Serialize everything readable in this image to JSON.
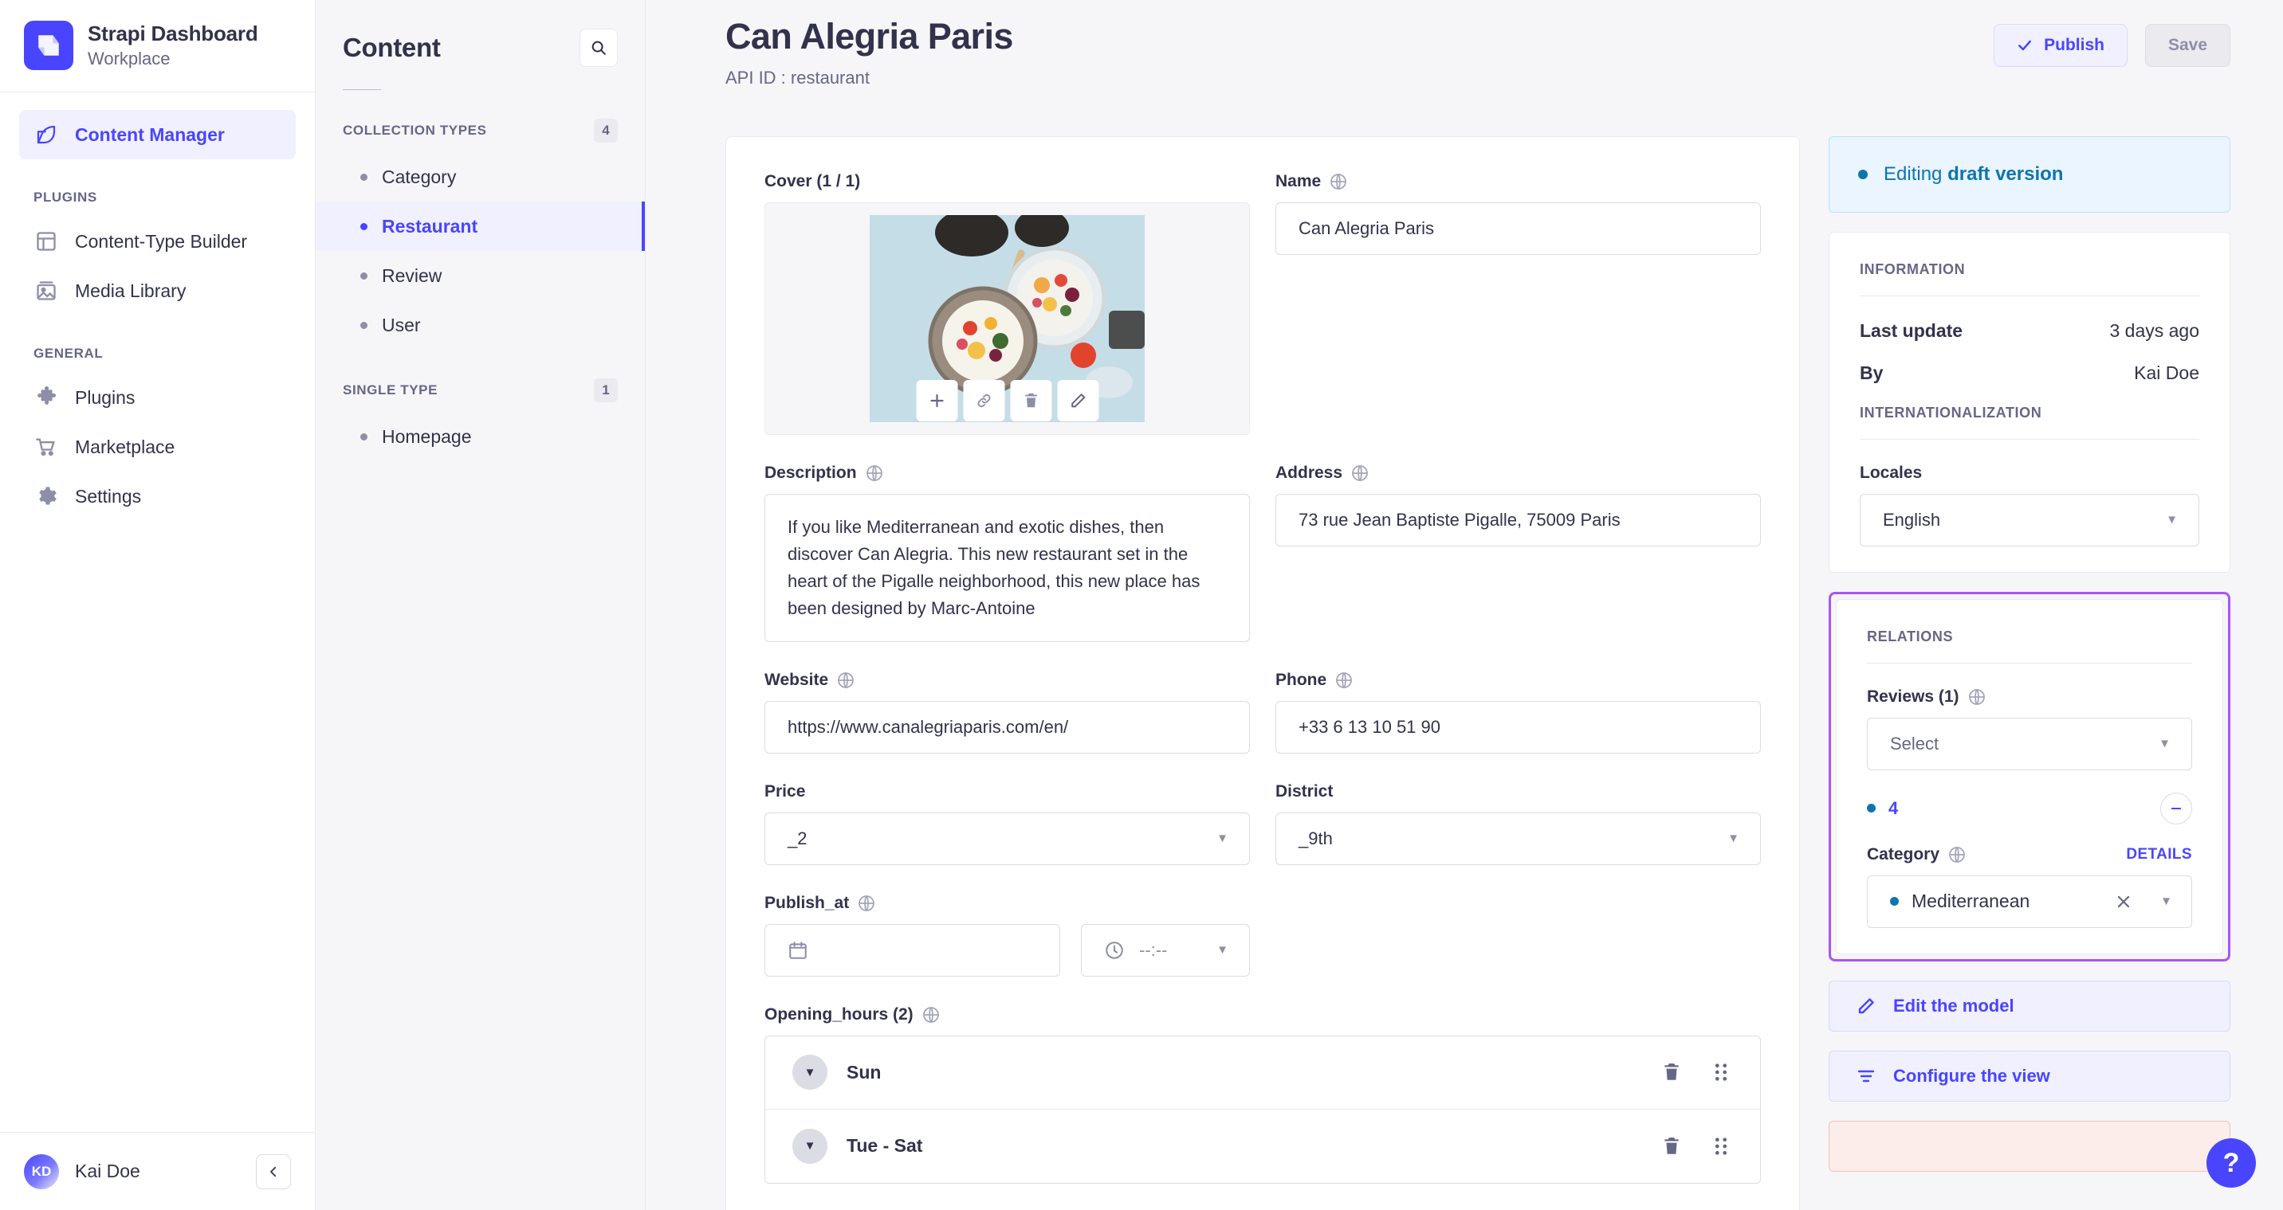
{
  "sidebar": {
    "brand": {
      "title": "Strapi Dashboard",
      "subtitle": "Workplace",
      "logo_icon": "strapi-logo-icon"
    },
    "primary_items": [
      {
        "label": "Content Manager",
        "icon": "feather-pen-icon",
        "active": true
      }
    ],
    "sections": [
      {
        "label": "PLUGINS",
        "items": [
          {
            "label": "Content-Type Builder",
            "icon": "layout-grid-icon"
          },
          {
            "label": "Media Library",
            "icon": "image-icon"
          }
        ]
      },
      {
        "label": "GENERAL",
        "items": [
          {
            "label": "Plugins",
            "icon": "puzzle-piece-icon"
          },
          {
            "label": "Marketplace",
            "icon": "shopping-cart-icon"
          },
          {
            "label": "Settings",
            "icon": "gear-icon"
          }
        ]
      }
    ],
    "footer": {
      "user_initials": "KD",
      "user_name": "Kai Doe",
      "collapse_icon": "chevron-left-icon"
    }
  },
  "content_nav": {
    "title": "Content",
    "search_icon": "search-icon",
    "groups": [
      {
        "label": "COLLECTION TYPES",
        "count": "4",
        "items": [
          {
            "label": "Category",
            "active": false
          },
          {
            "label": "Restaurant",
            "active": true
          },
          {
            "label": "Review",
            "active": false
          },
          {
            "label": "User",
            "active": false
          }
        ]
      },
      {
        "label": "SINGLE TYPE",
        "count": "1",
        "items": [
          {
            "label": "Homepage",
            "active": false
          }
        ]
      }
    ]
  },
  "header": {
    "title": "Can Alegria Paris",
    "api_id": "API ID : restaurant",
    "publish_label": "Publish",
    "publish_icon": "check-icon",
    "save_label": "Save"
  },
  "form": {
    "cover": {
      "label": "Cover (1 / 1)",
      "actions": [
        {
          "icon": "plus-icon",
          "name": "add-media-button"
        },
        {
          "icon": "link-icon",
          "name": "copy-link-button"
        },
        {
          "icon": "trash-icon",
          "name": "delete-media-button"
        },
        {
          "icon": "pencil-icon",
          "name": "edit-media-button"
        }
      ]
    },
    "name": {
      "label": "Name",
      "value": "Can Alegria Paris",
      "i18n_icon": "globe-icon"
    },
    "description": {
      "label": "Description",
      "value": "If you like Mediterranean and exotic dishes, then discover Can Alegria. This new restaurant set in the heart of the Pigalle neighborhood, this new place has been designed by Marc-Antoine",
      "i18n_icon": "globe-icon"
    },
    "address": {
      "label": "Address",
      "value": "73 rue Jean Baptiste Pigalle, 75009 Paris",
      "i18n_icon": "globe-icon"
    },
    "website": {
      "label": "Website",
      "value": "https://www.canalegriaparis.com/en/",
      "i18n_icon": "globe-icon"
    },
    "phone": {
      "label": "Phone",
      "value": "+33 6 13 10 51 90",
      "i18n_icon": "globe-icon"
    },
    "price": {
      "label": "Price",
      "value": "_2"
    },
    "district": {
      "label": "District",
      "value": "_9th"
    },
    "publish_at": {
      "label": "Publish_at",
      "date_value": "",
      "date_icon": "calendar-icon",
      "time_value": "--:--",
      "time_icon": "clock-icon",
      "i18n_icon": "globe-icon"
    },
    "opening_hours": {
      "label": "Opening_hours (2)",
      "i18n_icon": "globe-icon",
      "rows": [
        {
          "label": "Sun",
          "toggle_icon": "chevron-down-icon",
          "delete_icon": "trash-icon",
          "drag_icon": "drag-handle-icon"
        },
        {
          "label": "Tue - Sat",
          "toggle_icon": "chevron-down-icon",
          "delete_icon": "trash-icon",
          "drag_icon": "drag-handle-icon"
        }
      ]
    }
  },
  "right_panel": {
    "draft_banner": {
      "prefix": "Editing ",
      "emphasis": "draft version"
    },
    "information": {
      "title": "INFORMATION",
      "rows": [
        {
          "key": "Last update",
          "value": "3 days ago"
        },
        {
          "key": "By",
          "value": "Kai Doe"
        }
      ]
    },
    "internationalization": {
      "title": "INTERNATIONALIZATION",
      "locales_label": "Locales",
      "locale_value": "English"
    },
    "relations": {
      "title": "RELATIONS",
      "reviews_label": "Reviews (1)",
      "reviews_placeholder": "Select",
      "reviews_i18n_icon": "globe-icon",
      "selected_review_count": "4",
      "remove_icon": "minus-circle-icon",
      "category_label": "Category",
      "category_i18n_icon": "globe-icon",
      "details_label": "DETAILS",
      "category_value": "Mediterranean",
      "clear_icon": "close-icon"
    },
    "actions": [
      {
        "label": "Edit the model",
        "icon": "pencil-icon"
      },
      {
        "label": "Configure the view",
        "icon": "sliders-icon"
      }
    ]
  },
  "help": {
    "icon": "question-mark-icon",
    "label": "?"
  }
}
